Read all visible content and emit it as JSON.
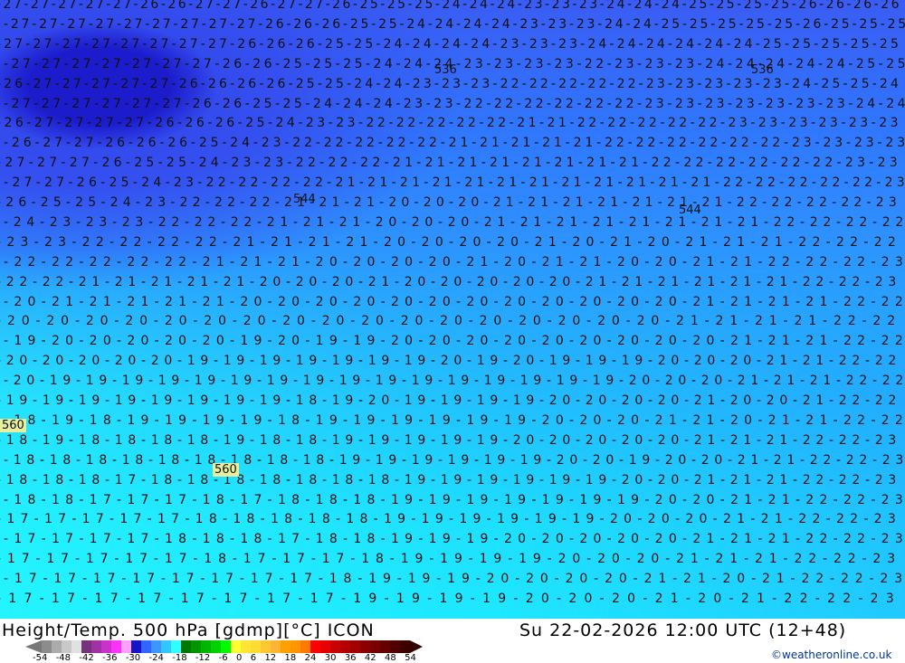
{
  "map": {
    "rows": [
      "-27-27-27-27-27-26-26-27-27-26-27-27-26-25-25-25-24-24-24-23-23-23-24-24-24-25-25-25-25-26-26-26-26",
      "-27-27-27-27-27-27-27-27-27-26-26-26-25-25-24-24-24-24-23-23-23-24-24-25-25-25-25-25-26-25-25-25",
      "-27-27-27-27-27-27-27-27-26-26-26-25-25-24-24-24-24-23-23-23-24-24-24-24-24-24-25-25-25-25-25",
      "-27-27-27-27-27-27-27-26-26-25-25-25-24-24-24-23-23-23-23-22-23-23-23-24-24-24-24-24-25-25",
      "-26-27-27-27-27-27-26-26-26-26-25-25-24-24-23-23-23-22-22-22-22-22-23-23-23-23-23-24-25-25-24",
      "-27-27-27-27-27-27-26-26-25-25-24-24-24-23-23-22-22-22-22-22-22-23-23-23-23-23-23-23-24-24",
      "-26-27-27-27-27-26-26-26-25-24-23-23-22-22-22-22-22-21-21-22-22-22-22-22-23-23-23-23-23-23",
      "-26-27-27-26-26-26-25-24-23-22-22-22-22-22-21-21-21-21-21-22-22-22-22-22-22-23-23-23-23",
      "-27-27-27-26-25-25-24-23-23-22-22-22-21-21-21-21-21-21-21-21-22-22-22-22-22-22-23-23",
      "-27-27-26-25-24-23-22-22-22-22-21-21-21-21-21-21-21-21-21-21-21-21-22-22-22-22-22-23",
      "-26-25-25-24-23-22-22-22-21-21-21-20-20-20-21-21-21-21-21-21-21-22-22-22-22-23",
      "-24-23-23-23-22-22-22-21-21-21-20-20-20-21-21-21-21-21-21-21-21-22-22-22-22",
      "-23-23-22-22-22-22-21-21-21-21-20-20-20-20-21-20-21-20-21-21-21-22-22-22",
      "-22-22-22-22-22-21-21-21-20-20-20-20-21-20-21-21-20-20-21-21-22-22-22-23",
      "-22-22-21-21-21-21-21-20-20-20-21-20-20-20-20-20-21-21-21-21-21-21-22-22-23",
      "-20-21-21-21-21-21-20-20-20-20-20-20-20-20-20-20-20-20-21-21-21-21-22-22",
      "-20-20-20-20-20-20-20-20-20-20-20-20-20-20-20-20-20-21-21-21-21-22-22",
      "-19-20-20-20-20-20-19-20-19-19-20-20-20-20-20-20-20-20-20-21-21-21-22-22",
      "-20-20-20-20-20-19-19-19-19-19-19-19-20-19-20-19-19-19-20-20-20-21-21-22-22",
      "-20-19-19-19-19-19-19-19-19-19-19-19-19-19-19-19-19-20-20-20-21-21-21-22-22",
      "-19-19-19-19-19-19-19-19-18-19-20-19-19-19-19-20-20-20-20-21-20-20-21-22-22",
      "-18-19-18-19-19-19-19-18-19-19-19-19-19-19-20-20-20-21-21-20-21-21-22-22",
      "-18-19-18-18-18-18-19-18-18-19-19-19-19-19-20-20-20-20-20-21-21-21-22-22-23",
      "-18-18-18-18-18-18-18-18-18-19-19-19-19-19-19-20-20-19-20-20-21-21-22-22-23",
      "-18-18-18-17-18-18-18-18-18-18-18-19-19-19-19-19-19-20-20-21-21-21-22-22-23",
      "-18-18-17-17-17-18-17-18-18-18-19-19-19-19-19-19-19-20-20-21-21-22-22-23",
      "-17-17-17-17-17-18-18-18-18-18-19-19-19-19-19-19-20-20-20-21-21-22-22-23",
      "-17-17-17-17-18-18-18-17-18-18-19-19-19-20-20-20-20-20-21-21-21-22-22-23",
      "-17-17-17-17-17-18-17-17-17-18-19-19-19-19-20-20-20-21-21-21-22-22-23",
      "-17-17-17-17-17-17-17-17-18-19-19-19-20-20-20-20-21-21-20-21-22-22-23",
      "-17-17-17-17-17-17-17-17-19-19-19-19-20-20-20-21-20-21-22-22-23"
    ],
    "contour_labels": [
      "536",
      "536",
      "544",
      "544",
      "560",
      "560"
    ]
  },
  "legend": {
    "title": "Height/Temp. 500 hPa [gdmp][°C] ICON",
    "datetime": "Su 22-02-2026 12:00 UTC (12+48)",
    "credit": "©weatheronline.co.uk",
    "ticks": [
      "-54",
      "-48",
      "-42",
      "-36",
      "-30",
      "-24",
      "-18",
      "-12",
      "-6",
      "0",
      "6",
      "12",
      "18",
      "24",
      "30",
      "36",
      "42",
      "48",
      "54"
    ],
    "colors": [
      "#8c8c8c",
      "#ababab",
      "#c8c8c8",
      "#e1e1e1",
      "#78327d",
      "#a032a5",
      "#c832c8",
      "#fa32fa",
      "#ffa0ff",
      "#1414c8",
      "#3264ff",
      "#3c96ff",
      "#32c8ff",
      "#32ffff",
      "#007800",
      "#009600",
      "#00b400",
      "#00d200",
      "#00fa00",
      "#ffff32",
      "#ffe632",
      "#ffdc32",
      "#ffc832",
      "#ffb432",
      "#ffa000",
      "#ff9600",
      "#ff7800",
      "#ff0000",
      "#e60000",
      "#c80000",
      "#b40000",
      "#a00000",
      "#8c0000",
      "#780000",
      "#640000",
      "#500000",
      "#3c0000"
    ]
  }
}
